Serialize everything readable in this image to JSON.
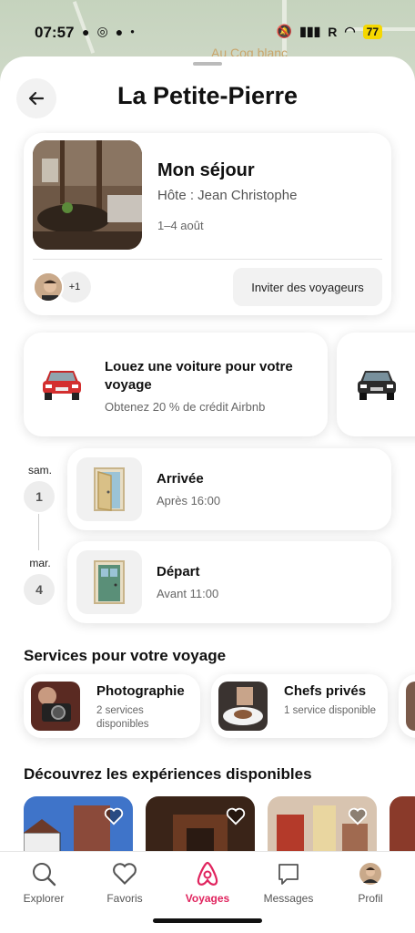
{
  "status_bar": {
    "time": "07:57",
    "carrier": "R",
    "battery": "77",
    "map_label": "Au Coq blanc"
  },
  "header": {
    "title": "La Petite-Pierre",
    "back_icon": "arrow-left-icon"
  },
  "stay": {
    "title": "Mon séjour",
    "host": "Hôte : Jean Christophe",
    "dates": "1–4 août",
    "extra_guests": "+1",
    "invite_label": "Inviter des voyageurs"
  },
  "car_promo": {
    "title": "Louez une voiture pour votre voyage",
    "subtitle": "Obtenez 20 % de crédit Airbnb"
  },
  "timeline": [
    {
      "weekday": "sam.",
      "day": "1",
      "title": "Arrivée",
      "subtitle": "Après 16:00",
      "icon": "open-door-icon"
    },
    {
      "weekday": "mar.",
      "day": "4",
      "title": "Départ",
      "subtitle": "Avant 11:00",
      "icon": "closed-door-icon"
    }
  ],
  "services": {
    "heading": "Services pour votre voyage",
    "items": [
      {
        "title": "Photographie",
        "subtitle": "2 services disponibles"
      },
      {
        "title": "Chefs privés",
        "subtitle": "1 service disponible"
      }
    ]
  },
  "experiences": {
    "heading": "Découvrez les expériences disponibles"
  },
  "tabbar": {
    "items": [
      {
        "label": "Explorer",
        "icon": "search-icon"
      },
      {
        "label": "Favoris",
        "icon": "heart-icon"
      },
      {
        "label": "Voyages",
        "icon": "airbnb-logo-icon",
        "active": true
      },
      {
        "label": "Messages",
        "icon": "message-icon"
      },
      {
        "label": "Profil",
        "icon": "avatar-icon"
      }
    ]
  },
  "colors": {
    "accent": "#e0245e",
    "map_bg": "#c9d4c2"
  }
}
